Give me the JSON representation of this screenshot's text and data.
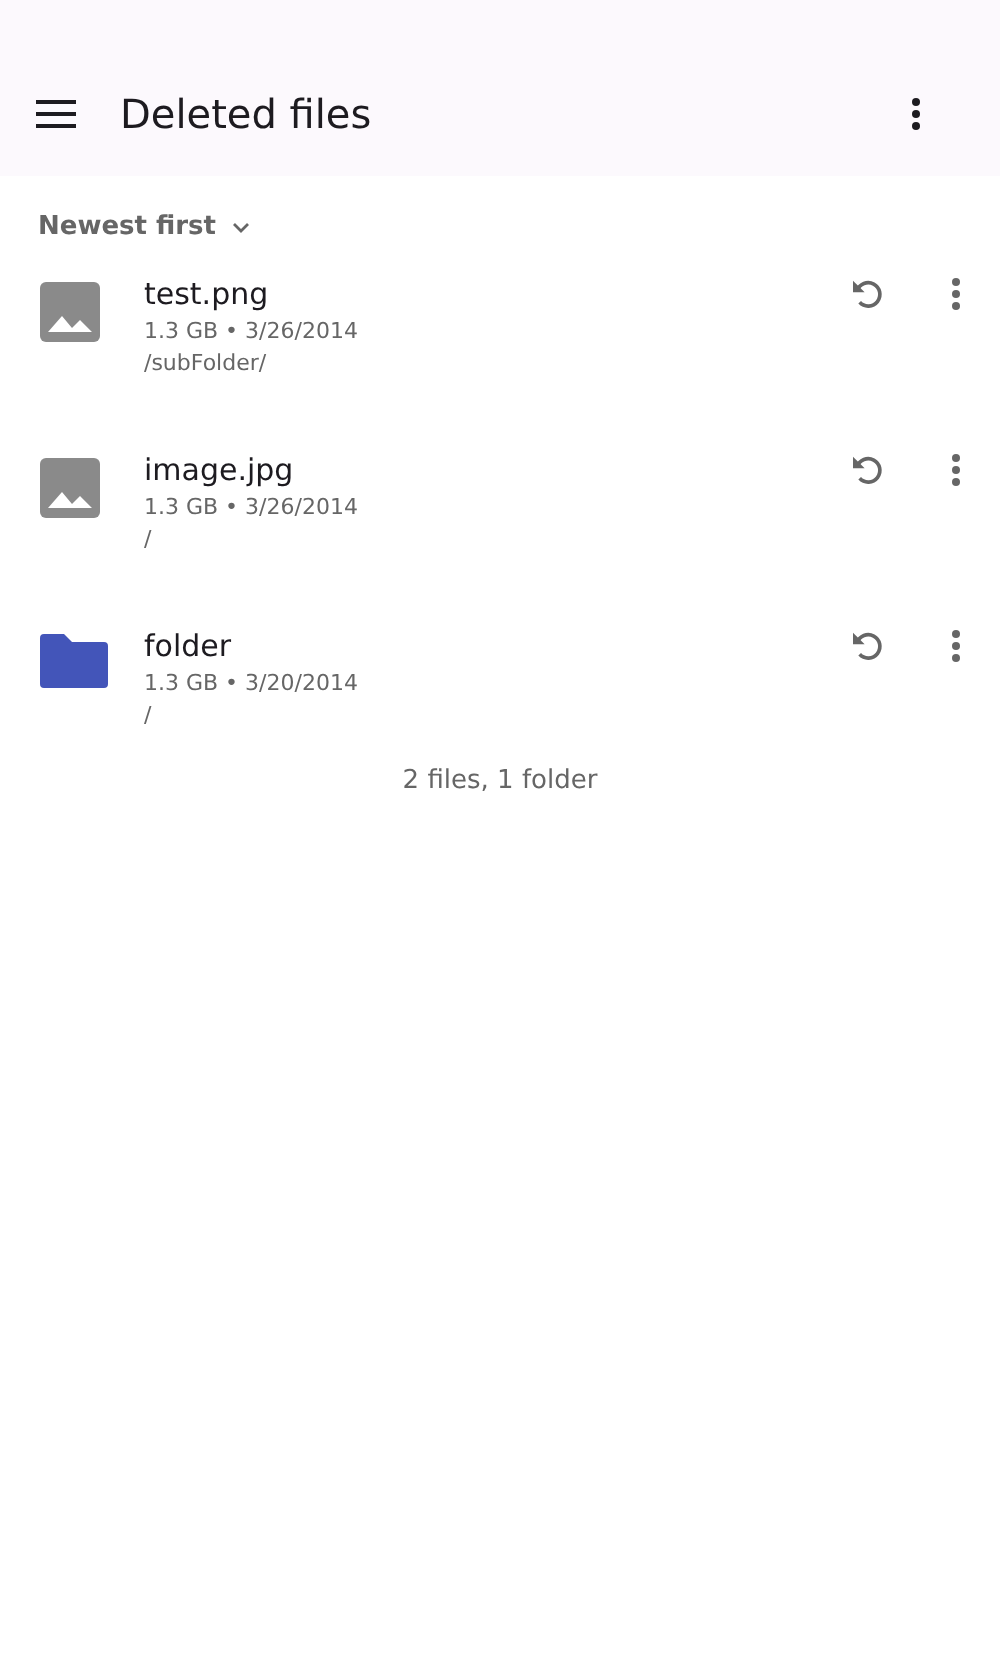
{
  "app_bar": {
    "title": "Deleted files"
  },
  "sort": {
    "label": "Newest first"
  },
  "items": [
    {
      "kind": "image",
      "name": "test.png",
      "meta": "1.3 GB • 3/26/2014",
      "path": "/subFolder/"
    },
    {
      "kind": "image",
      "name": "image.jpg",
      "meta": "1.3 GB • 3/26/2014",
      "path": "/"
    },
    {
      "kind": "folder",
      "name": "folder",
      "meta": "1.3 GB • 3/20/2014",
      "path": "/"
    }
  ],
  "summary": "2 files, 1 folder"
}
